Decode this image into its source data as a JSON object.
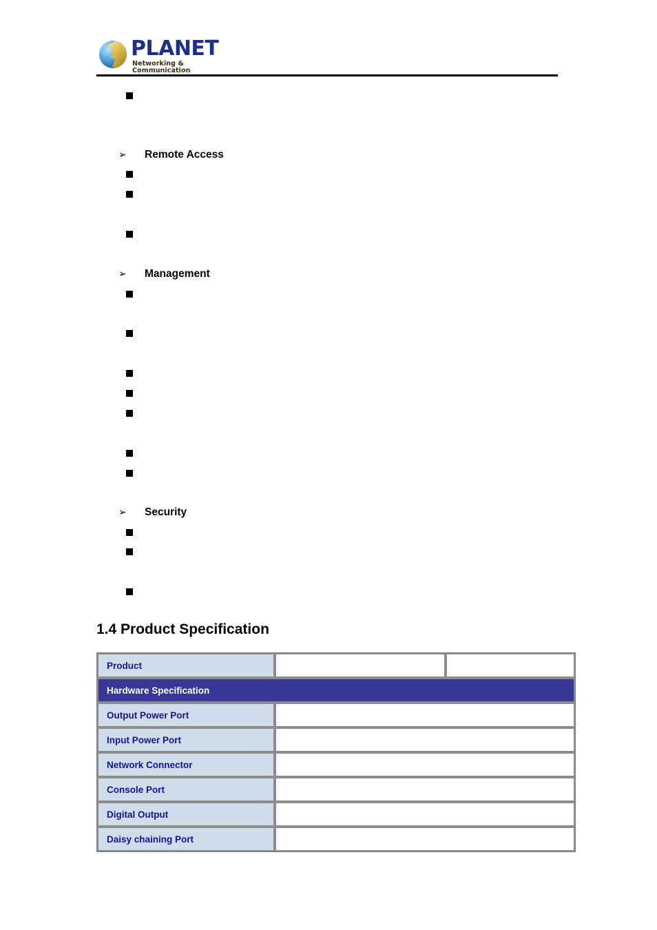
{
  "page": {
    "brand": {
      "wordmark": "PLANET",
      "tagline": "Networking & Communication",
      "logo_icon": "planet-globe-logo",
      "accent_color": "#1d2f8a"
    }
  },
  "features": {
    "orphan_bullet": {
      "marker": "■",
      "text": ""
    },
    "groups": [
      {
        "marker": "➢",
        "label": "Remote Access",
        "bullets": [
          {
            "marker": "■",
            "text": ""
          },
          {
            "marker": "■",
            "text": ""
          },
          {
            "marker": "■",
            "text": ""
          }
        ]
      },
      {
        "marker": "➢",
        "label": "Management",
        "bullets": [
          {
            "marker": "■",
            "text": ""
          },
          {
            "marker": "■",
            "text": ""
          },
          {
            "marker": "■",
            "text": ""
          },
          {
            "marker": "■",
            "text": ""
          },
          {
            "marker": "■",
            "text": ""
          },
          {
            "marker": "■",
            "text": ""
          },
          {
            "marker": "■",
            "text": ""
          }
        ]
      },
      {
        "marker": "➢",
        "label": "Security",
        "bullets": [
          {
            "marker": "■",
            "text": ""
          },
          {
            "marker": "■",
            "text": ""
          },
          {
            "marker": "■",
            "text": ""
          }
        ]
      }
    ]
  },
  "section": {
    "heading": "1.4 Product Specification"
  },
  "spec_table": {
    "colors": {
      "label_bg": "#cfdcea",
      "label_text": "#141493",
      "band_bg": "#373795",
      "band_text": "#ffffff",
      "border": "#8c8c8c"
    },
    "rows": [
      {
        "type": "triple",
        "label": "Product",
        "value_1": "",
        "value_2": ""
      },
      {
        "type": "band",
        "label": "Hardware Specification"
      },
      {
        "type": "pair",
        "label": "Output Power Port",
        "value": ""
      },
      {
        "type": "pair",
        "label": "Input Power Port",
        "value": ""
      },
      {
        "type": "pair",
        "label": "Network Connector",
        "value": ""
      },
      {
        "type": "pair",
        "label": "Console Port",
        "value": ""
      },
      {
        "type": "pair",
        "label": "Digital Output",
        "value": ""
      },
      {
        "type": "pair",
        "label": "Daisy chaining Port",
        "value": ""
      }
    ]
  }
}
